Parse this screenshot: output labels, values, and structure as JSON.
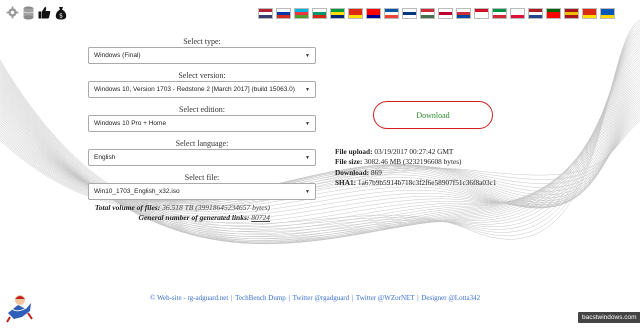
{
  "toolbar": {
    "icons": [
      "gear-icon",
      "database-icon",
      "thumbs-up-icon",
      "money-bag-icon"
    ]
  },
  "flags": [
    {
      "name": "flag-us",
      "colors": [
        "#b22234",
        "#ffffff",
        "#3c3b6e"
      ]
    },
    {
      "name": "flag-ru",
      "colors": [
        "#ffffff",
        "#0039a6",
        "#d52b1e"
      ]
    },
    {
      "name": "flag-az",
      "colors": [
        "#00b5e2",
        "#ef3340",
        "#509e2f"
      ]
    },
    {
      "name": "flag-bg",
      "colors": [
        "#ffffff",
        "#00966e",
        "#d62612"
      ]
    },
    {
      "name": "flag-br",
      "colors": [
        "#009c3b",
        "#ffdf00",
        "#002776"
      ]
    },
    {
      "name": "flag-cn",
      "colors": [
        "#de2910",
        "#de2910",
        "#ffde00"
      ]
    },
    {
      "name": "flag-tw",
      "colors": [
        "#fe0000",
        "#fe0000",
        "#000095"
      ]
    },
    {
      "name": "flag-fr",
      "colors": [
        "#0055a4",
        "#ffffff",
        "#ef4135"
      ]
    },
    {
      "name": "flag-fi",
      "colors": [
        "#ffffff",
        "#003580",
        "#ffffff"
      ]
    },
    {
      "name": "flag-hu",
      "colors": [
        "#ce2939",
        "#ffffff",
        "#477050"
      ]
    },
    {
      "name": "flag-jp",
      "colors": [
        "#ffffff",
        "#bc002d",
        "#ffffff"
      ]
    },
    {
      "name": "flag-kr",
      "colors": [
        "#ffffff",
        "#cd2e3a",
        "#0047a0"
      ]
    },
    {
      "name": "flag-id",
      "colors": [
        "#ce1126",
        "#ffffff",
        "#ffffff"
      ]
    },
    {
      "name": "flag-it",
      "colors": [
        "#009246",
        "#ffffff",
        "#ce2b37"
      ]
    },
    {
      "name": "flag-pl",
      "colors": [
        "#ffffff",
        "#ffffff",
        "#dc143c"
      ]
    },
    {
      "name": "flag-nl",
      "colors": [
        "#ae1c28",
        "#ffffff",
        "#21468b"
      ]
    },
    {
      "name": "flag-pt",
      "colors": [
        "#006600",
        "#ff0000",
        "#ff0000"
      ]
    },
    {
      "name": "flag-es",
      "colors": [
        "#aa151b",
        "#f1bf00",
        "#aa151b"
      ]
    },
    {
      "name": "flag-cn2",
      "colors": [
        "#de2910",
        "#de2910",
        "#ffde00"
      ]
    },
    {
      "name": "flag-ua",
      "colors": [
        "#0057b7",
        "#0057b7",
        "#ffd700"
      ]
    }
  ],
  "form": {
    "type_label": "Select type:",
    "type_value": "Windows (Final)",
    "version_label": "Select version:",
    "version_value": "Windows 10, Version 1703 - Redstone 2 [March 2017] (build 15063.0)",
    "edition_label": "Select edition:",
    "edition_value": "Windows 10 Pro + Home",
    "language_label": "Select language:",
    "language_value": "English",
    "file_label": "Select file:",
    "file_value": "Win10_1703_English_x32.iso"
  },
  "totals": {
    "volume_label": "Total volume of files:",
    "volume_value": "36.518 TB (39918645234657 bytes)",
    "links_label": "General number of generated links:",
    "links_value": "80724"
  },
  "download": {
    "button_label": "Download"
  },
  "info": {
    "upload_label": "File upload:",
    "upload_value": "03/19/2017 00:27:42 GMT",
    "size_label": "File size:",
    "size_value": "3082.46 MB (3232196608 bytes)",
    "download_label": "Download:",
    "download_value": "869",
    "sha1_label": "SHA1:",
    "sha1_value": "1a67b9b5914b718c3f2f6e58907f51c36f8a03c1"
  },
  "footer": {
    "links": [
      "© Web-site - rg-adguard.net",
      "TechBench Dump",
      "Twitter @rgadguard",
      "Twitter @WZorNET",
      "Designer @Lotta342"
    ],
    "separator": "|"
  },
  "badge": {
    "text": "bacstwindows.com"
  },
  "colors": {
    "download_border": "#d02020",
    "download_text": "#2a8a2a",
    "footer_link": "#3a6fd0"
  }
}
